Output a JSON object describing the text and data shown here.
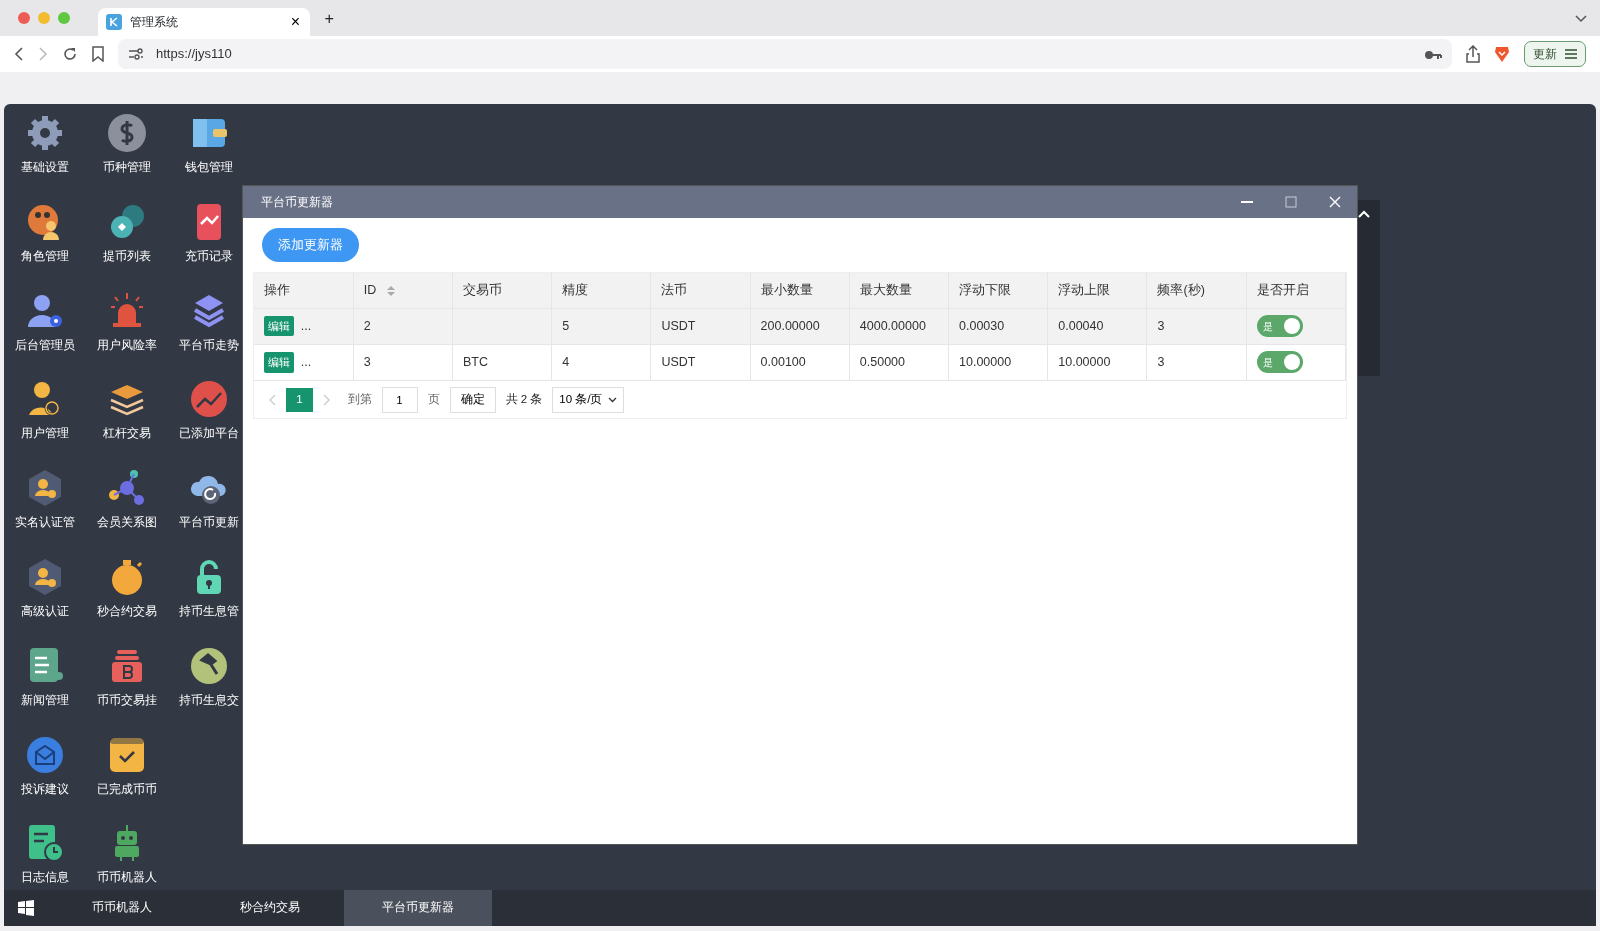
{
  "browser": {
    "tab": {
      "title": "管理系统",
      "close": "×"
    },
    "new_tab": "+",
    "url": "https://jys110",
    "update_button": "更新"
  },
  "desktop": {
    "icons": [
      {
        "label": "基础设置"
      },
      {
        "label": "角色管理"
      },
      {
        "label": "后台管理员"
      },
      {
        "label": "用户管理"
      },
      {
        "label": "实名认证管"
      },
      {
        "label": "高级认证"
      },
      {
        "label": "新闻管理"
      },
      {
        "label": "投诉建议"
      },
      {
        "label": "日志信息"
      },
      {
        "label": "币种管理"
      },
      {
        "label": "提币列表"
      },
      {
        "label": "用户风险率"
      },
      {
        "label": "杠杆交易"
      },
      {
        "label": "会员关系图"
      },
      {
        "label": "秒合约交易"
      },
      {
        "label": "币币交易挂"
      },
      {
        "label": "已完成币币"
      },
      {
        "label": "币币机器人"
      },
      {
        "label": "钱包管理"
      },
      {
        "label": "充币记录"
      },
      {
        "label": "平台币走势"
      },
      {
        "label": "已添加平台"
      },
      {
        "label": "平台币更新"
      },
      {
        "label": "持币生息管"
      },
      {
        "label": "持币生息交"
      }
    ]
  },
  "window": {
    "title": "平台币更新器",
    "add_button": "添加更新器",
    "table": {
      "columns": [
        "操作",
        "ID",
        "交易币",
        "精度",
        "法币",
        "最小数量",
        "最大数量",
        "浮动下限",
        "浮动上限",
        "频率(秒)",
        "是否开启"
      ],
      "rows": [
        {
          "highlighted": true,
          "cells": [
            {
              "kind": "actions",
              "edit": "编辑",
              "more": "..."
            },
            {
              "kind": "text",
              "text": "2"
            },
            {
              "kind": "text",
              "text": ""
            },
            {
              "kind": "text",
              "text": "5"
            },
            {
              "kind": "text",
              "text": "USDT"
            },
            {
              "kind": "text",
              "text": "200.00000"
            },
            {
              "kind": "text",
              "text": "4000.00000"
            },
            {
              "kind": "text",
              "text": "0.00030"
            },
            {
              "kind": "text",
              "text": "0.00040"
            },
            {
              "kind": "text",
              "text": "3"
            },
            {
              "kind": "toggle",
              "label": "是",
              "on": true
            }
          ]
        },
        {
          "highlighted": false,
          "cells": [
            {
              "kind": "actions",
              "edit": "编辑",
              "more": "..."
            },
            {
              "kind": "text",
              "text": "3"
            },
            {
              "kind": "text",
              "text": "BTC"
            },
            {
              "kind": "text",
              "text": "4"
            },
            {
              "kind": "text",
              "text": "USDT"
            },
            {
              "kind": "text",
              "text": "0.00100"
            },
            {
              "kind": "text",
              "text": "0.50000"
            },
            {
              "kind": "text",
              "text": "10.00000"
            },
            {
              "kind": "text",
              "text": "10.00000"
            },
            {
              "kind": "text",
              "text": "3"
            },
            {
              "kind": "toggle",
              "label": "是",
              "on": true
            }
          ]
        }
      ]
    },
    "pagination": {
      "pages": [
        {
          "label": "1",
          "selected": true
        }
      ],
      "goto_label": "到第",
      "goto_value": "1",
      "page_unit": "页",
      "confirm": "确定",
      "total": "共 2 条",
      "page_size": "10 条/页"
    }
  },
  "taskbar": {
    "tasks": [
      {
        "label": "币币机器人",
        "selected": false
      },
      {
        "label": "秒合约交易",
        "selected": false
      },
      {
        "label": "平台币更新器",
        "selected": true
      }
    ]
  }
}
